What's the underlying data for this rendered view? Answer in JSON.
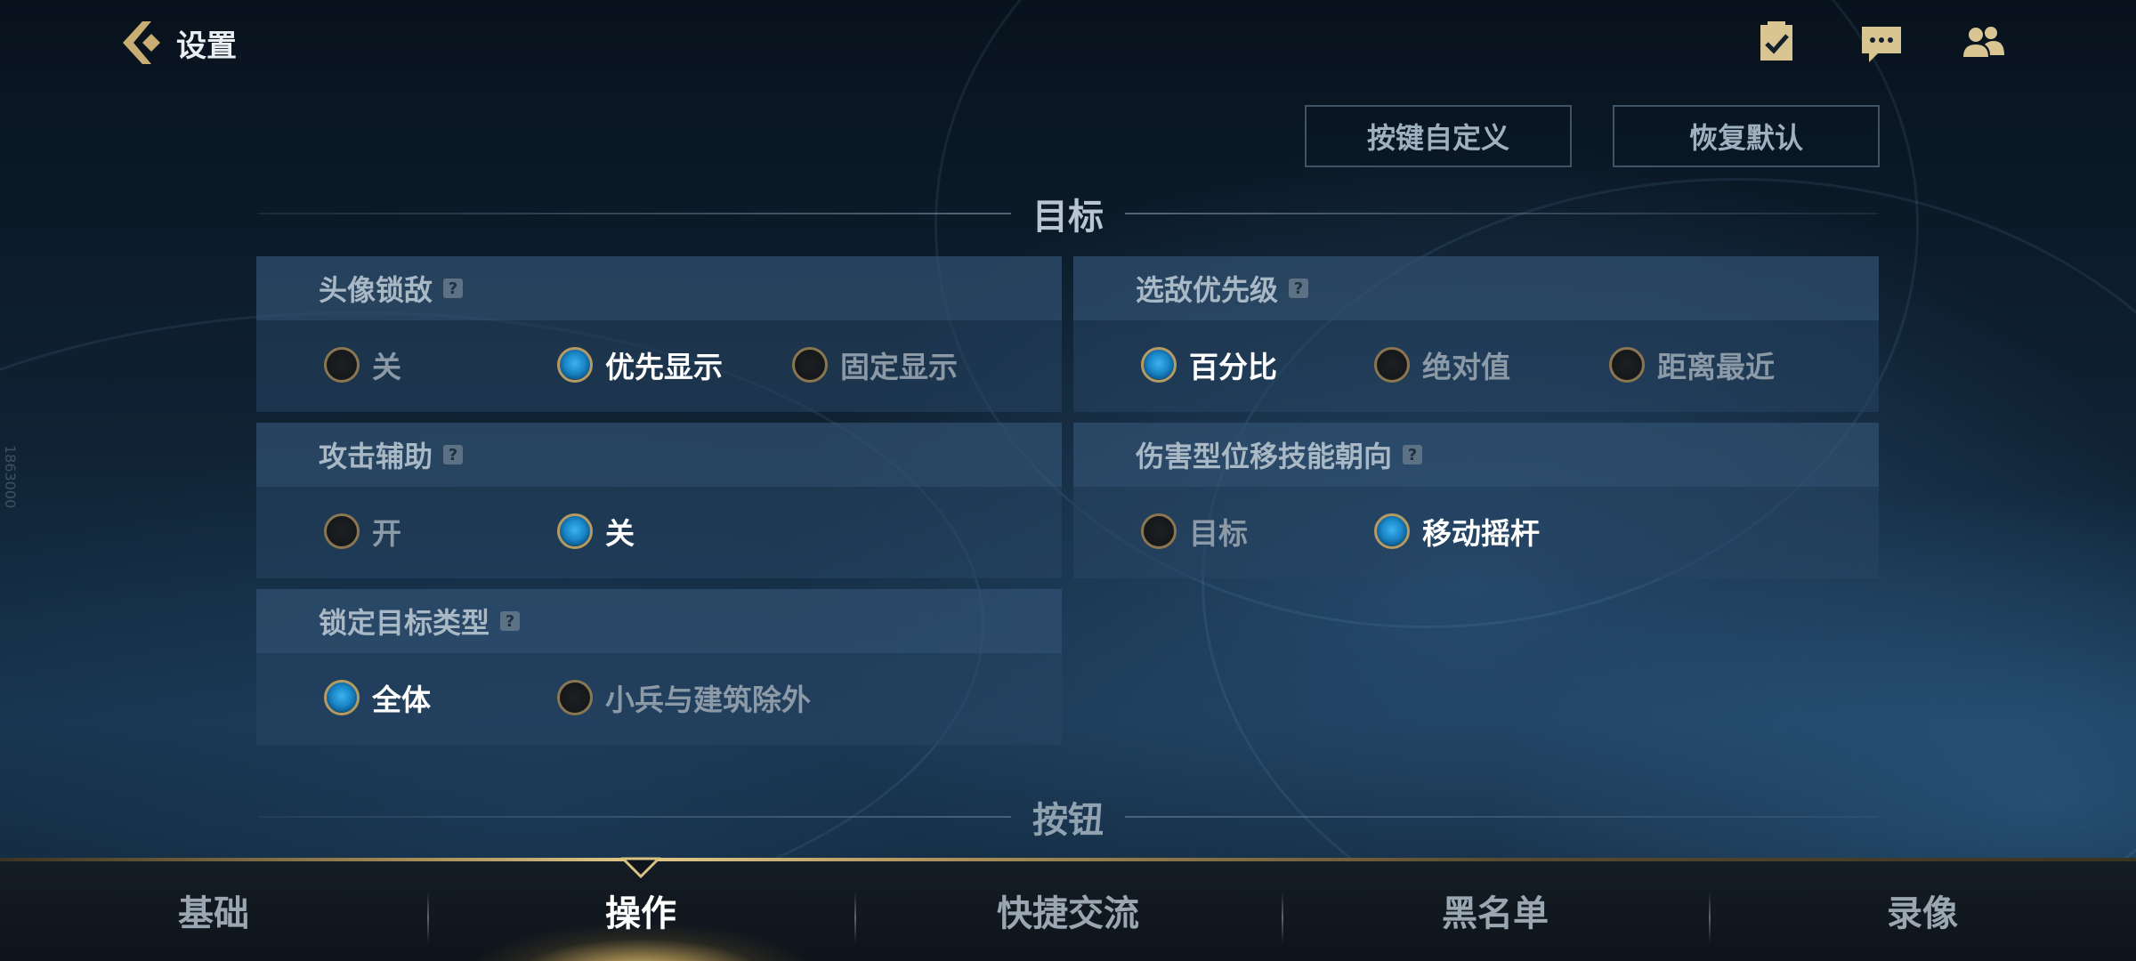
{
  "header": {
    "title": "设置",
    "icons": [
      "task-icon",
      "chat-icon",
      "friends-icon"
    ]
  },
  "side_text": "1863000",
  "actions": {
    "customize_keys": "按键自定义",
    "restore_default": "恢复默认"
  },
  "sections": {
    "target": "目标",
    "buttons": "按钮"
  },
  "settings": {
    "avatar_lock": {
      "title": "头像锁敌",
      "options": [
        "关",
        "优先显示",
        "固定显示"
      ],
      "selected": 1
    },
    "enemy_priority": {
      "title": "选敌优先级",
      "options": [
        "百分比",
        "绝对值",
        "距离最近"
      ],
      "selected": 0
    },
    "attack_assist": {
      "title": "攻击辅助",
      "options": [
        "开",
        "关"
      ],
      "selected": 1
    },
    "damage_skill_direction": {
      "title": "伤害型位移技能朝向",
      "options": [
        "目标",
        "移动摇杆"
      ],
      "selected": 1
    },
    "lock_target_type": {
      "title": "锁定目标类型",
      "options": [
        "全体",
        "小兵与建筑除外"
      ],
      "selected": 0
    }
  },
  "tabs": {
    "items": [
      "基础",
      "操作",
      "快捷交流",
      "黑名单",
      "录像"
    ],
    "active": 1
  },
  "colors": {
    "accent_gold": "#b59b62",
    "radio_on_blue": "#1a86c8",
    "text_muted": "#8b9aa6"
  }
}
